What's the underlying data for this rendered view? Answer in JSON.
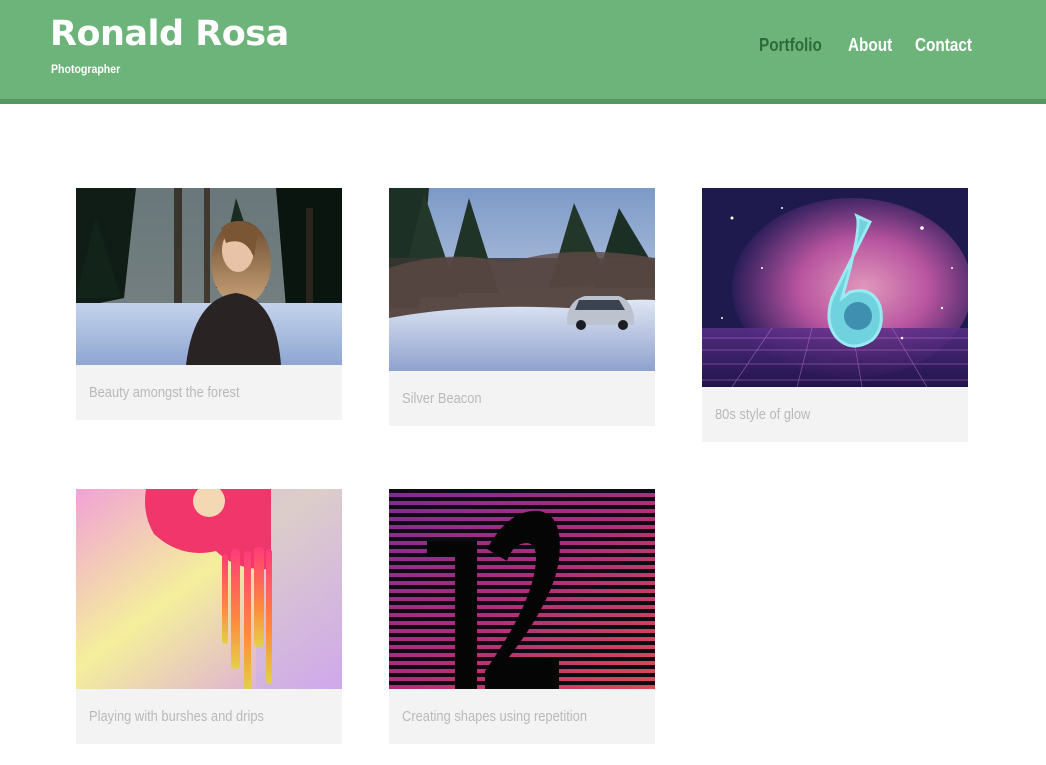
{
  "site": {
    "title": "Ronald Rosa",
    "tagline": "Photographer",
    "brand_color": "#6db47a",
    "active_nav_color": "#2e6b38"
  },
  "nav": [
    {
      "label": "Portfolio",
      "active": true
    },
    {
      "label": "About",
      "active": false
    },
    {
      "label": "Contact",
      "active": false
    }
  ],
  "portfolio": [
    {
      "caption": "Beauty amongst the forest",
      "image": "woman-in-snowy-forest"
    },
    {
      "caption": "Silver Beacon",
      "image": "silver-car-in-snowy-woods"
    },
    {
      "caption": "80s style of glow",
      "image": "neon-number-six"
    },
    {
      "caption": "Playing with burshes and drips",
      "image": "paint-drips-number-nine"
    },
    {
      "caption": "Creating shapes using repetition",
      "image": "striped-number-twelve"
    }
  ]
}
